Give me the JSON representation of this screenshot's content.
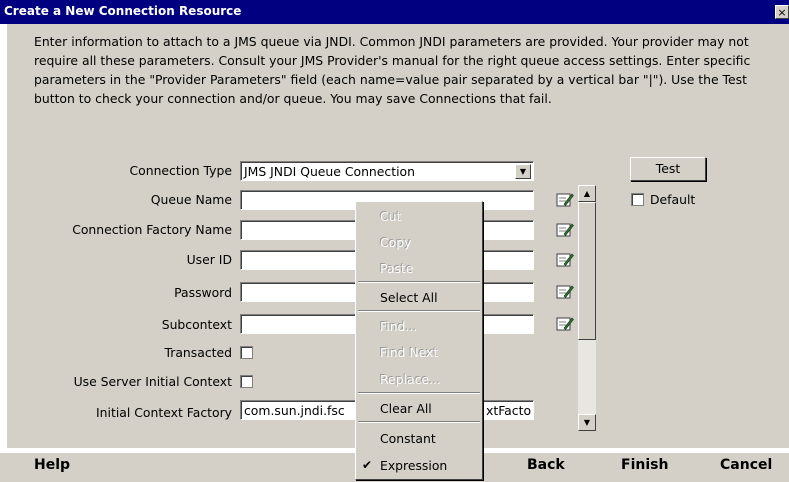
{
  "window": {
    "title": "Create a New Connection Resource",
    "close_glyph": "×"
  },
  "description": "Enter information to attach to a JMS queue via JNDI. Common JNDI parameters are provided. Your provider may not require all these parameters. Consult your JMS Provider's manual for the right queue access settings. Enter specific parameters in the \"Provider Parameters\" field (each name=value pair separated by a vertical bar \"|\"). Use the Test button to check your connection and/or queue. You may save Connections that fail.",
  "form": {
    "connection_type": {
      "label": "Connection Type",
      "value": "JMS JNDI Queue Connection"
    },
    "queue_name": {
      "label": "Queue Name",
      "value": ""
    },
    "connection_factory_name": {
      "label": "Connection Factory Name",
      "value": ""
    },
    "user_id": {
      "label": "User ID",
      "value": ""
    },
    "password": {
      "label": "Password",
      "value": ""
    },
    "subcontext": {
      "label": "Subcontext",
      "value": ""
    },
    "transacted": {
      "label": "Transacted",
      "checked": false
    },
    "use_server_initial_context": {
      "label": "Use Server Initial Context",
      "checked": false
    },
    "initial_context_factory": {
      "label": "Initial Context Factory",
      "value": "com.sun.jndi.fscontext.RefFSContextFacto",
      "left_part": "com.sun.jndi.fsc",
      "right_part": "xtFacto"
    }
  },
  "side": {
    "test_label": "Test",
    "default_label": "Default",
    "default_checked": false
  },
  "context_menu": {
    "items": [
      {
        "label": "Cut",
        "enabled": false
      },
      {
        "label": "Copy",
        "enabled": false
      },
      {
        "label": "Paste",
        "enabled": false
      },
      {
        "label": "Select All",
        "enabled": true
      },
      {
        "label": "Find...",
        "enabled": false
      },
      {
        "label": "Find Next",
        "enabled": false
      },
      {
        "label": "Replace...",
        "enabled": false
      },
      {
        "label": "Clear All",
        "enabled": true
      },
      {
        "label": "Constant",
        "enabled": true
      },
      {
        "label": "Expression",
        "enabled": true,
        "checked": true
      }
    ],
    "check_glyph": "✔"
  },
  "bottom": {
    "help": "Help",
    "back": "Back",
    "finish": "Finish",
    "cancel": "Cancel"
  },
  "colors": {
    "titlebar": "#000080",
    "panel": "#d4d0c8"
  }
}
